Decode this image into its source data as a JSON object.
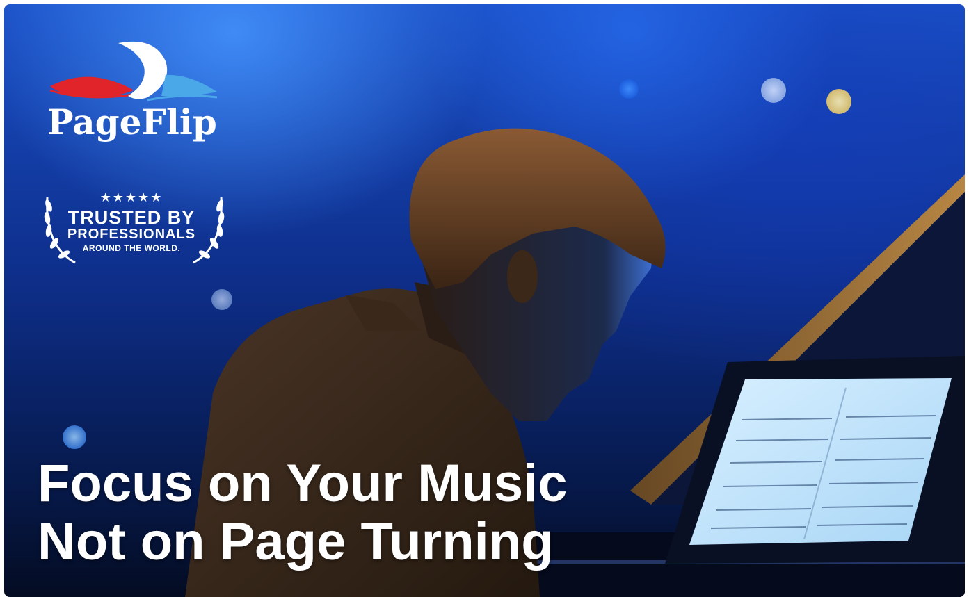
{
  "brand": {
    "name": "PageFlip",
    "logo_icon": "page-flip-logo-icon",
    "colors": {
      "red": "#e0242a",
      "white": "#ffffff",
      "blue": "#4aa8e8"
    }
  },
  "badge": {
    "stars": "★★★★★",
    "line1": "TRUSTED BY",
    "line2": "PROFESSIONALS",
    "line3": "AROUND THE WORLD.",
    "icon": "laurel-wreath-icon"
  },
  "headline": {
    "line1": "Focus on Your Music",
    "line2": "Not on Page Turning"
  },
  "image": {
    "subject_icon": "pianist-with-tablet-sheet-music"
  }
}
